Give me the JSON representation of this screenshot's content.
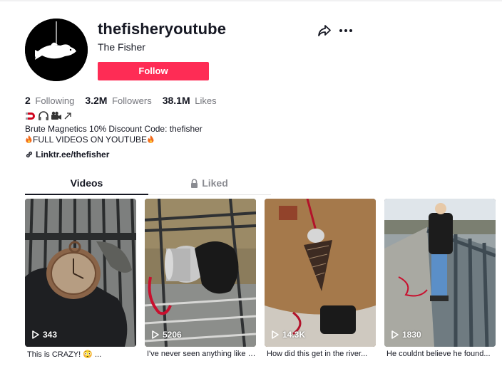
{
  "profile": {
    "username": "thefisheryoutube",
    "nickname": "The Fisher",
    "follow_label": "Follow",
    "stats": [
      {
        "value": "2",
        "label": "Following"
      },
      {
        "value": "3.2M",
        "label": "Followers"
      },
      {
        "value": "38.1M",
        "label": "Likes"
      }
    ],
    "bio_line1": "Brute Magnetics 10% Discount Code: thefisher",
    "bio_line2": "FULL VIDEOS ON YOUTUBE",
    "link": "Linktr.ee/thefisher"
  },
  "tabs": {
    "videos": "Videos",
    "liked": "Liked"
  },
  "videos": [
    {
      "views": "343",
      "caption": "This is CRAZY! 😳 ..."
    },
    {
      "views": "5206",
      "caption": "I've never seen anything like this..."
    },
    {
      "views": "14.3K",
      "caption": "How did this get in the river..."
    },
    {
      "views": "1830",
      "caption": "He couldnt believe he found..."
    }
  ],
  "colors": {
    "follow_button": "#fe2c55",
    "muted_text": "#73747b",
    "tab_inactive": "#8a8b91"
  }
}
